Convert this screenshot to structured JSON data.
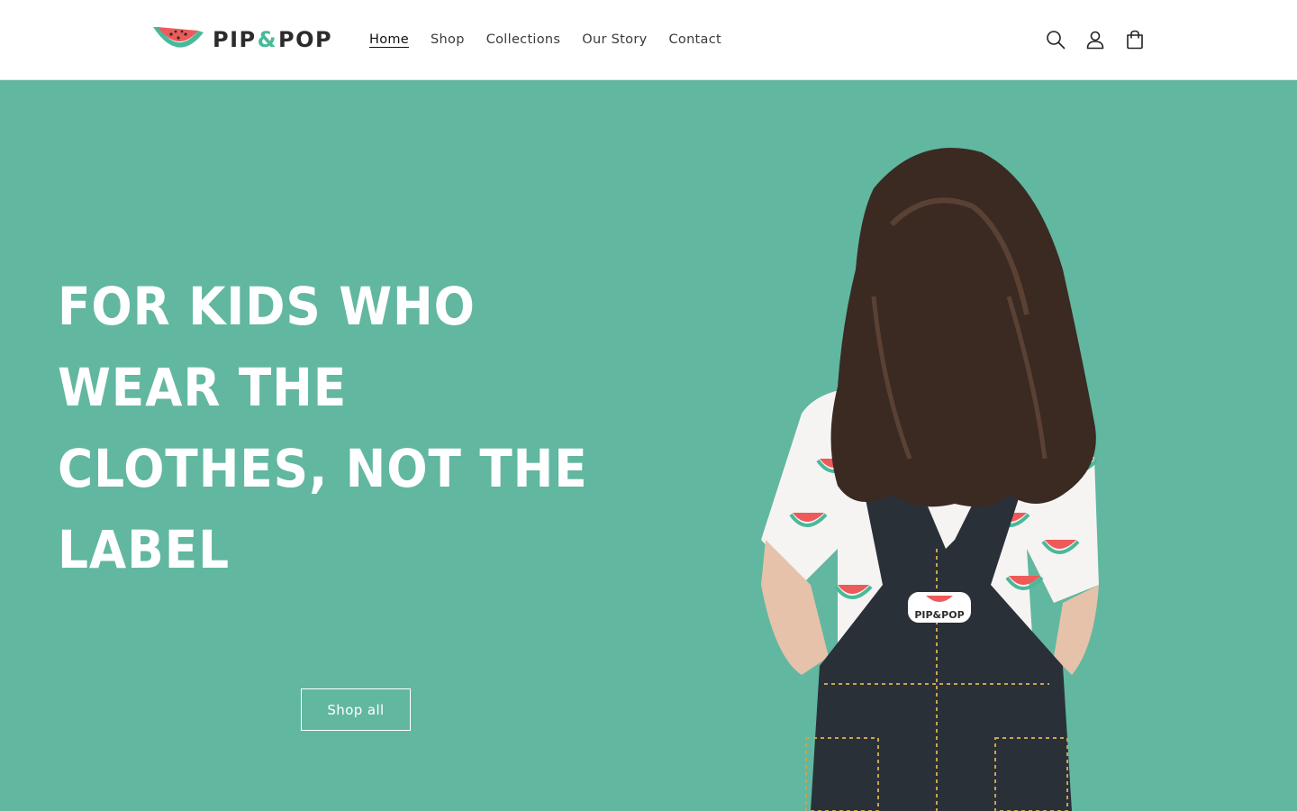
{
  "brand": {
    "name_left": "PIP",
    "name_amp": "&",
    "name_right": "POP",
    "accent_color": "#49b99a",
    "watermelon_red": "#ee5a5a"
  },
  "nav": {
    "items": [
      {
        "label": "Home",
        "active": true
      },
      {
        "label": "Shop",
        "active": false
      },
      {
        "label": "Collections",
        "active": false
      },
      {
        "label": "Our Story",
        "active": false
      },
      {
        "label": "Contact",
        "active": false
      }
    ]
  },
  "header_icons": [
    "search-icon",
    "account-icon",
    "cart-icon"
  ],
  "hero": {
    "background": "#62b7a0",
    "heading_line1": "FOR KIDS WHO WEAR THE",
    "heading_line2": "CLOTHES, NOT THE LABEL",
    "button_label": "Shop all",
    "patch_text": "PIP&POP"
  }
}
